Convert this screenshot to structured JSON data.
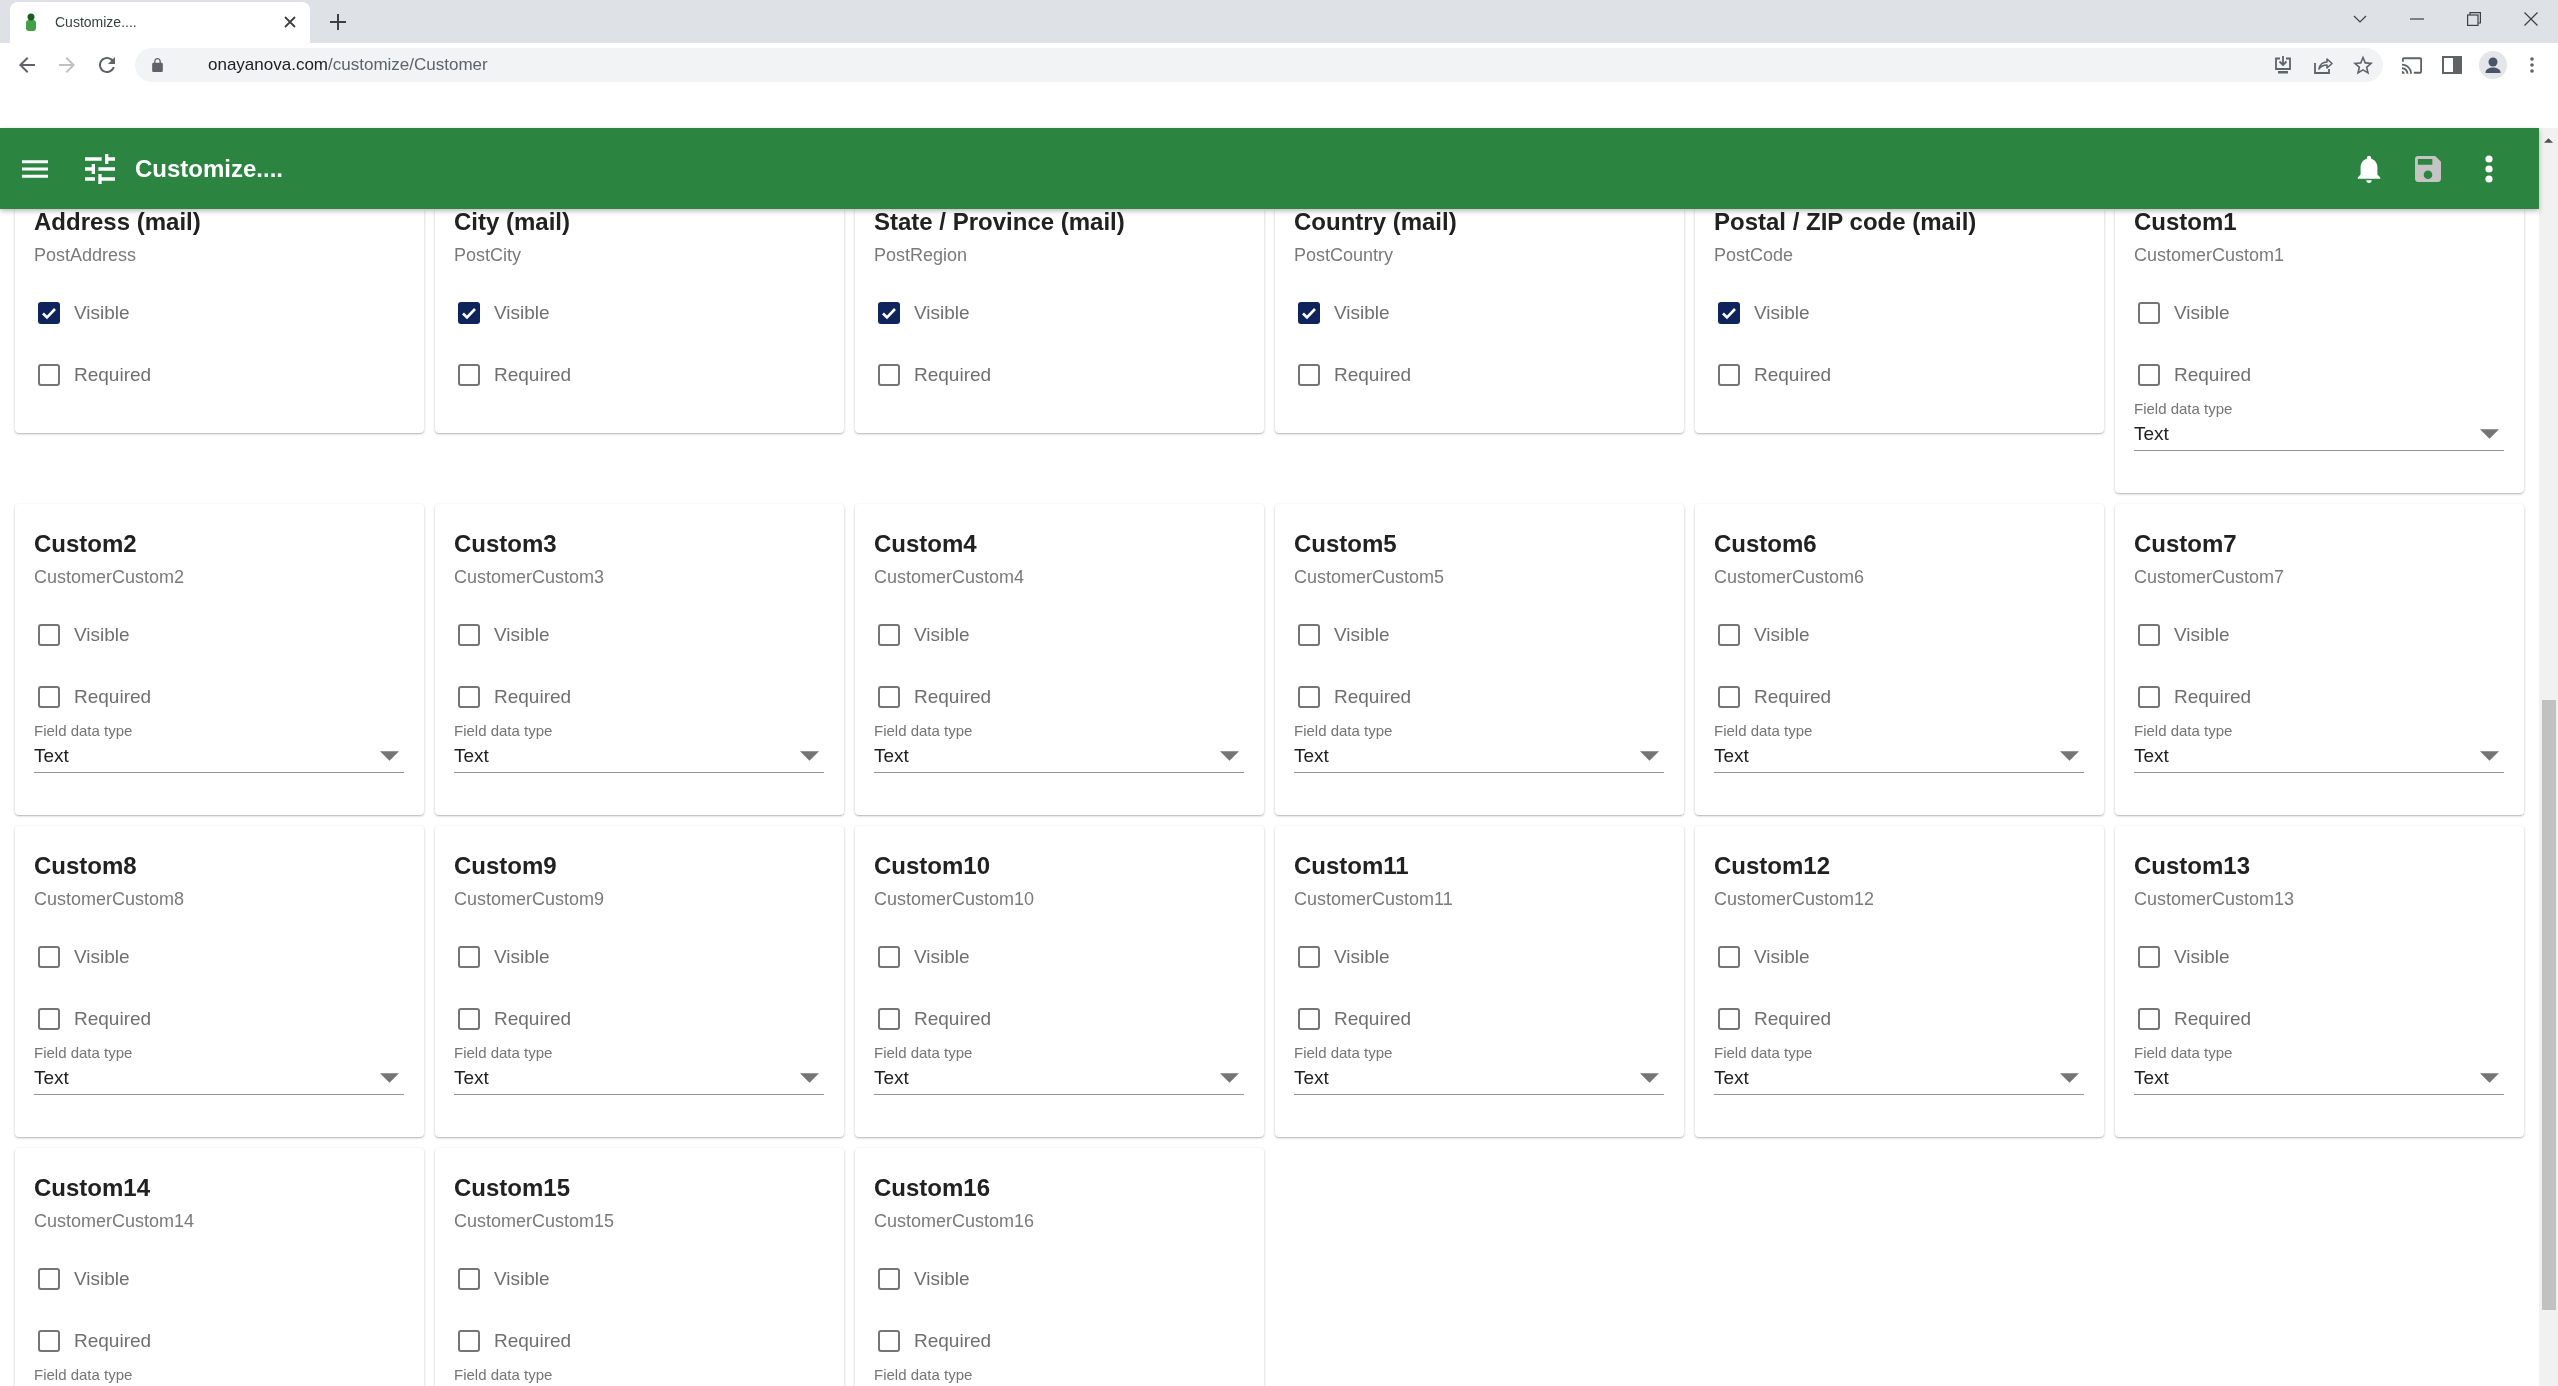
{
  "browser": {
    "tab_title": "Customize....",
    "url_host": "onayanova.com",
    "url_path": "/customize/Customer",
    "forward_disabled": true
  },
  "app_bar": {
    "title": "Customize....",
    "save_disabled": true
  },
  "cards": [
    {
      "title": "Address (mail)",
      "field": "PostAddress",
      "checkboxes": [
        {
          "label": "Visible",
          "checked": true
        },
        {
          "label": "Required",
          "checked": false
        }
      ]
    },
    {
      "title": "City (mail)",
      "field": "PostCity",
      "checkboxes": [
        {
          "label": "Visible",
          "checked": true
        },
        {
          "label": "Required",
          "checked": false
        }
      ]
    },
    {
      "title": "State / Province (mail)",
      "field": "PostRegion",
      "checkboxes": [
        {
          "label": "Visible",
          "checked": true
        },
        {
          "label": "Required",
          "checked": false
        }
      ]
    },
    {
      "title": "Country (mail)",
      "field": "PostCountry",
      "checkboxes": [
        {
          "label": "Visible",
          "checked": true
        },
        {
          "label": "Required",
          "checked": false
        }
      ]
    },
    {
      "title": "Postal / ZIP code (mail)",
      "field": "PostCode",
      "checkboxes": [
        {
          "label": "Visible",
          "checked": true
        },
        {
          "label": "Required",
          "checked": false
        }
      ]
    },
    {
      "title": "Custom1",
      "field": "CustomerCustom1",
      "checkboxes": [
        {
          "label": "Visible",
          "checked": false
        },
        {
          "label": "Required",
          "checked": false
        }
      ],
      "data_type": {
        "label": "Field data type",
        "value": "Text"
      }
    },
    {
      "title": "Custom2",
      "field": "CustomerCustom2",
      "checkboxes": [
        {
          "label": "Visible",
          "checked": false
        },
        {
          "label": "Required",
          "checked": false
        }
      ],
      "data_type": {
        "label": "Field data type",
        "value": "Text"
      }
    },
    {
      "title": "Custom3",
      "field": "CustomerCustom3",
      "checkboxes": [
        {
          "label": "Visible",
          "checked": false
        },
        {
          "label": "Required",
          "checked": false
        }
      ],
      "data_type": {
        "label": "Field data type",
        "value": "Text"
      }
    },
    {
      "title": "Custom4",
      "field": "CustomerCustom4",
      "checkboxes": [
        {
          "label": "Visible",
          "checked": false
        },
        {
          "label": "Required",
          "checked": false
        }
      ],
      "data_type": {
        "label": "Field data type",
        "value": "Text"
      }
    },
    {
      "title": "Custom5",
      "field": "CustomerCustom5",
      "checkboxes": [
        {
          "label": "Visible",
          "checked": false
        },
        {
          "label": "Required",
          "checked": false
        }
      ],
      "data_type": {
        "label": "Field data type",
        "value": "Text"
      }
    },
    {
      "title": "Custom6",
      "field": "CustomerCustom6",
      "checkboxes": [
        {
          "label": "Visible",
          "checked": false
        },
        {
          "label": "Required",
          "checked": false
        }
      ],
      "data_type": {
        "label": "Field data type",
        "value": "Text"
      }
    },
    {
      "title": "Custom7",
      "field": "CustomerCustom7",
      "checkboxes": [
        {
          "label": "Visible",
          "checked": false
        },
        {
          "label": "Required",
          "checked": false
        }
      ],
      "data_type": {
        "label": "Field data type",
        "value": "Text"
      }
    },
    {
      "title": "Custom8",
      "field": "CustomerCustom8",
      "checkboxes": [
        {
          "label": "Visible",
          "checked": false
        },
        {
          "label": "Required",
          "checked": false
        }
      ],
      "data_type": {
        "label": "Field data type",
        "value": "Text"
      }
    },
    {
      "title": "Custom9",
      "field": "CustomerCustom9",
      "checkboxes": [
        {
          "label": "Visible",
          "checked": false
        },
        {
          "label": "Required",
          "checked": false
        }
      ],
      "data_type": {
        "label": "Field data type",
        "value": "Text"
      }
    },
    {
      "title": "Custom10",
      "field": "CustomerCustom10",
      "checkboxes": [
        {
          "label": "Visible",
          "checked": false
        },
        {
          "label": "Required",
          "checked": false
        }
      ],
      "data_type": {
        "label": "Field data type",
        "value": "Text"
      }
    },
    {
      "title": "Custom11",
      "field": "CustomerCustom11",
      "checkboxes": [
        {
          "label": "Visible",
          "checked": false
        },
        {
          "label": "Required",
          "checked": false
        }
      ],
      "data_type": {
        "label": "Field data type",
        "value": "Text"
      }
    },
    {
      "title": "Custom12",
      "field": "CustomerCustom12",
      "checkboxes": [
        {
          "label": "Visible",
          "checked": false
        },
        {
          "label": "Required",
          "checked": false
        }
      ],
      "data_type": {
        "label": "Field data type",
        "value": "Text"
      }
    },
    {
      "title": "Custom13",
      "field": "CustomerCustom13",
      "checkboxes": [
        {
          "label": "Visible",
          "checked": false
        },
        {
          "label": "Required",
          "checked": false
        }
      ],
      "data_type": {
        "label": "Field data type",
        "value": "Text"
      }
    },
    {
      "title": "Custom14",
      "field": "CustomerCustom14",
      "checkboxes": [
        {
          "label": "Visible",
          "checked": false
        },
        {
          "label": "Required",
          "checked": false
        }
      ],
      "data_type": {
        "label": "Field data type"
      }
    },
    {
      "title": "Custom15",
      "field": "CustomerCustom15",
      "checkboxes": [
        {
          "label": "Visible",
          "checked": false
        },
        {
          "label": "Required",
          "checked": false
        }
      ],
      "data_type": {
        "label": "Field data type"
      }
    },
    {
      "title": "Custom16",
      "field": "CustomerCustom16",
      "checkboxes": [
        {
          "label": "Visible",
          "checked": false
        },
        {
          "label": "Required",
          "checked": false
        }
      ],
      "data_type": {
        "label": "Field data type"
      }
    }
  ]
}
